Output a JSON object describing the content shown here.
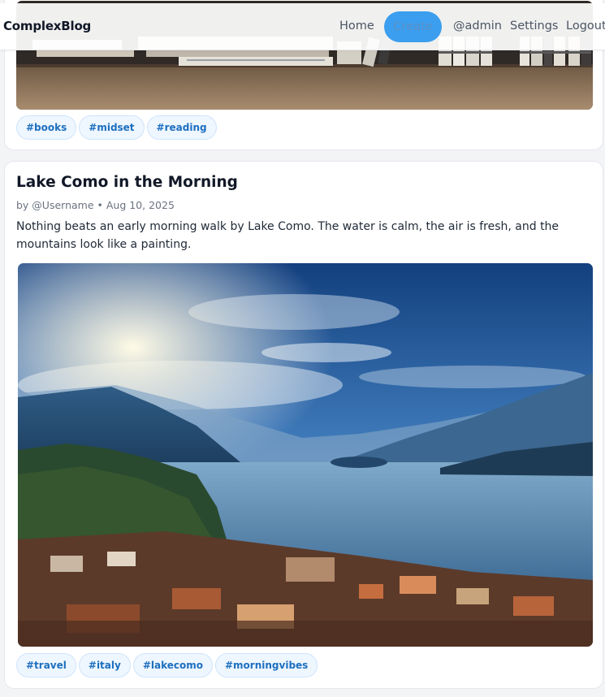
{
  "header": {
    "brand": "ComplexBlog",
    "nav": {
      "home": "Home",
      "create": "Create",
      "user": "@admin",
      "settings": "Settings",
      "logout": "Logout"
    }
  },
  "posts": [
    {
      "image_subject": "books-on-shelf",
      "tags": [
        "#books",
        "#midset",
        "#reading"
      ]
    },
    {
      "title": "Lake Como in the Morning",
      "author": "@Username",
      "date": "Aug 10, 2025",
      "meta": "by @Username • Aug 10, 2025",
      "body": "Nothing beats an early morning walk by Lake Como. The water is calm, the air is fresh, and the mountains look like a painting.",
      "image_subject": "lake-como-landscape",
      "tags": [
        "#travel",
        "#italy",
        "#lakecomo",
        "#morningvibes"
      ]
    }
  ],
  "colors": {
    "accent": "#3b9eee",
    "tag_text": "#1d6fbf",
    "tag_bg": "#eef6ff"
  }
}
